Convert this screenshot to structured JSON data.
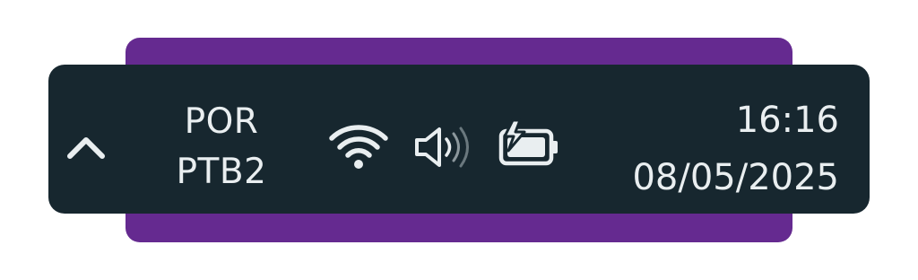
{
  "taskbar": {
    "show_hidden_icons": {
      "icon": "chevron-up-icon"
    },
    "input_language": {
      "line1": "POR",
      "line2": "PTB2"
    },
    "tray_icons": [
      {
        "icon": "wifi-icon"
      },
      {
        "icon": "volume-icon"
      },
      {
        "icon": "battery-charging-icon"
      }
    ],
    "clock": {
      "time": "16:16",
      "date": "08/05/2025"
    }
  },
  "colors": {
    "highlight": "#652a90",
    "taskbar_bg": "#17272f",
    "foreground": "#e9eef0"
  }
}
